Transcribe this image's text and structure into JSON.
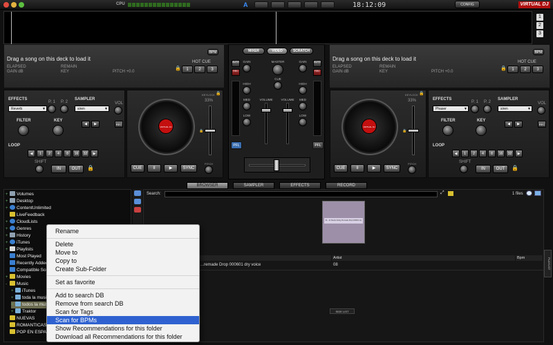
{
  "topbar": {
    "cpu_label": "CPU",
    "clock": "18:12:09",
    "config_label": "CONFIG",
    "brand": "VIRTUAL DJ",
    "crossfader_letter": "A"
  },
  "waveform": {
    "deck_numbers": [
      "1",
      "2",
      "3"
    ]
  },
  "deck_left": {
    "drag_text": "Drag a song on this deck to load it",
    "bpm_label": "BPM",
    "elapsed": "ELAPSED",
    "remain": "REMAIN",
    "gain": "GAIN dB",
    "key": "KEY",
    "pitch": "PITCH +0.0",
    "hotcue_label": "HOT CUE",
    "hotcues": [
      "1",
      "2",
      "3"
    ],
    "effects_label": "EFFECTS",
    "effect": "Reverb",
    "p1": "P. 1",
    "p2": "P. 2",
    "sampler_label": "SAMPLER",
    "sampler": "siren",
    "vol": "VOL",
    "rec": "REC",
    "filter": "FILTER",
    "keyknob": "KEY",
    "loop_label": "LOOP",
    "loops": [
      "1",
      "2",
      "4",
      "8",
      "16",
      "32"
    ],
    "shift": "SHIFT",
    "in": "IN",
    "out": "OUT",
    "keylock": "KEYLOCK",
    "pitch_pct": "33%",
    "pitch_label": "PITCH",
    "cue": "CUE",
    "pause": "II",
    "play": "▶",
    "sync": "SYNC",
    "platter_logo": "VIRTUAL DJ"
  },
  "deck_right": {
    "drag_text": "Drag a song on this deck to load it",
    "bpm_label": "BPM",
    "elapsed": "ELAPSED",
    "remain": "REMAIN",
    "gain": "GAIN dB",
    "key": "KEY",
    "pitch": "PITCH +0.0",
    "hotcue_label": "HOT CUE",
    "hotcues": [
      "1",
      "2",
      "3"
    ],
    "effects_label": "EFFECTS",
    "effect": "Phaser",
    "p1": "P. 1",
    "p2": "P. 2",
    "sampler_label": "SAMPLER",
    "sampler": "siren",
    "vol": "VOL",
    "rec": "REC",
    "filter": "FILTER",
    "keyknob": "KEY",
    "loop_label": "LOOP",
    "loops": [
      "1",
      "2",
      "4",
      "8",
      "16",
      "32"
    ],
    "shift": "SHIFT",
    "in": "IN",
    "out": "OUT",
    "keylock": "KEYLOCK",
    "pitch_pct": "33%",
    "pitch_label": "PITCH",
    "cue": "CUE",
    "pause": "II",
    "play": "▶",
    "sync": "SYNC",
    "platter_logo": "VIRTUAL DJ"
  },
  "mixer": {
    "tabs": [
      "MIXER",
      "VIDEO",
      "SCRATCH"
    ],
    "gain": "GAIN",
    "master": "MASTER",
    "cue": "CUE",
    "high": "HIGH",
    "med": "MED",
    "low": "LOW",
    "volume": "VOLUME",
    "pfl": "PFL",
    "auto": "AUTO",
    "rec": "REC"
  },
  "browser": {
    "tabs": [
      "BROWSER",
      "SAMPLER",
      "EFFECTS",
      "RECORD"
    ],
    "search_label": "Search:",
    "files_count": "1 files",
    "columns": [
      "Title",
      "Artist",
      "Bpm"
    ],
    "row": {
      "title": "...remade Drop 000601 dry voice",
      "artist": "08"
    },
    "cover_text": "01 - 11 Skunk Doing Premade Drop 000601 dry voice",
    "side_list": "SIDE LIST",
    "playlist": "PLAYLIST"
  },
  "tree": [
    {
      "label": "Volumes",
      "exp": "+",
      "color": "#8fa0b0"
    },
    {
      "label": "Desktop",
      "exp": "+",
      "color": "#8fa0b0"
    },
    {
      "label": "ContentUnlimited",
      "exp": "+",
      "color": "#3a7fd0"
    },
    {
      "label": "LiveFeedback",
      "exp": "",
      "color": "#d8c030"
    },
    {
      "label": "CloudLists",
      "exp": "+",
      "color": "#3a7fd0"
    },
    {
      "label": "Genres",
      "exp": "+",
      "color": "#3a7fd0"
    },
    {
      "label": "History",
      "exp": "+",
      "color": "#8fa0b0"
    },
    {
      "label": "iTunes",
      "exp": "+",
      "color": "#3a7fd0"
    },
    {
      "label": "Playlists",
      "exp": "+",
      "color": "#ddd"
    },
    {
      "label": "Most Played",
      "exp": "",
      "color": "#3a7fd0"
    },
    {
      "label": "Recently Added",
      "exp": "",
      "color": "#3a7fd0"
    },
    {
      "label": "Compatible Songs",
      "exp": "",
      "color": "#3a7fd0"
    },
    {
      "label": "Movies",
      "exp": "+",
      "color": "#d8c030"
    },
    {
      "label": "Music",
      "exp": "-",
      "color": "#d8c030"
    },
    {
      "label": "iTunes",
      "exp": "+",
      "color": "#7ab0d8"
    },
    {
      "label": "toda la musica",
      "exp": "+",
      "color": "#7ab0d8"
    },
    {
      "label": "todos la musica",
      "exp": "+",
      "color": "#7ab0d8"
    },
    {
      "label": "Traktor",
      "exp": "+",
      "color": "#7ab0d8"
    },
    {
      "label": "NUEVAS",
      "exp": "",
      "color": "#d8c030"
    },
    {
      "label": "ROMANTICAS",
      "exp": "",
      "color": "#d8c030"
    },
    {
      "label": "POP EN ESPAÑOL",
      "exp": "",
      "color": "#d8c030"
    }
  ],
  "context_menu": {
    "items": [
      "Rename",
      "Delete",
      "Move to",
      "Copy to",
      "Create Sub-Folder",
      "Set as favorite",
      "Add to search DB",
      "Remove from search DB",
      "Scan for Tags",
      "Scan for BPMs",
      "Show Recommendations for this folder",
      "Download all Recommendations for this folder"
    ],
    "highlighted": "Scan for BPMs",
    "highlight_color": "#2f62d0"
  }
}
